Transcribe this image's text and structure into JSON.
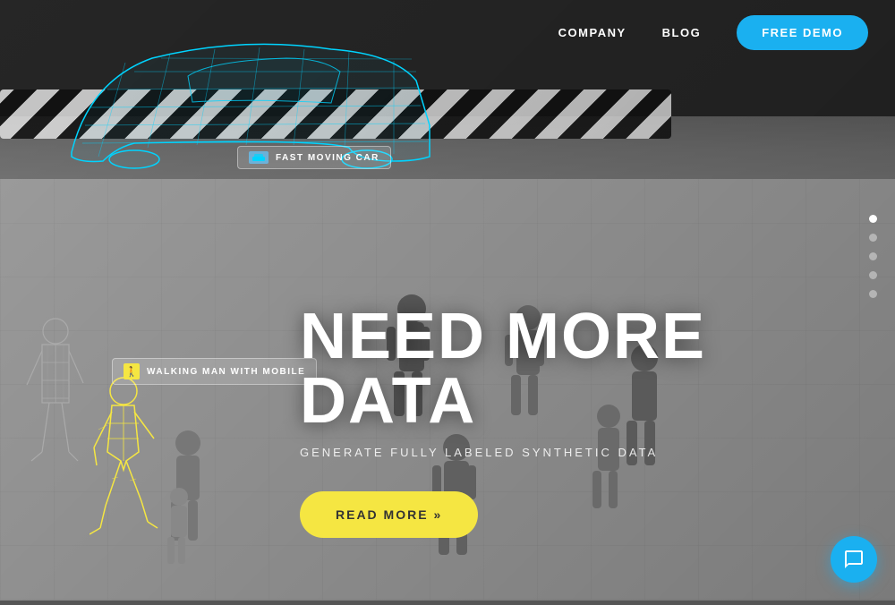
{
  "navbar": {
    "company_label": "COMPANY",
    "blog_label": "BLOG",
    "demo_label": "FREE DEMO"
  },
  "car_label": {
    "text": "FAST MOVING CAR"
  },
  "walk_label": {
    "text": "WALKING MAN WITH MOBILE"
  },
  "hero": {
    "headline": "NEED MORE DATA",
    "subtitle": "GENERATE FULLY LABELED SYNTHETIC DATA",
    "cta": "READ MORE »"
  },
  "dots": [
    {
      "active": true
    },
    {
      "active": false
    },
    {
      "active": false
    },
    {
      "active": false
    },
    {
      "active": false
    }
  ],
  "colors": {
    "cyan": "#00d4ff",
    "yellow": "#f5e642",
    "blue": "#1ab0f0",
    "white": "#ffffff"
  }
}
